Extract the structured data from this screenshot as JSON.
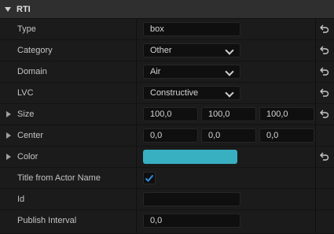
{
  "category": {
    "title": "RTI"
  },
  "rows": {
    "type": {
      "label": "Type",
      "value": "box"
    },
    "category": {
      "label": "Category",
      "value": "Other"
    },
    "domain": {
      "label": "Domain",
      "value": "Air"
    },
    "lvc": {
      "label": "LVC",
      "value": "Constructive"
    },
    "size": {
      "label": "Size",
      "x": "100,0",
      "y": "100,0",
      "z": "100,0"
    },
    "center": {
      "label": "Center",
      "x": "0,0",
      "y": "0,0",
      "z": "0,0"
    },
    "color": {
      "label": "Color",
      "swatch": "#38b0c2"
    },
    "title_from_actor": {
      "label": "Title from Actor Name",
      "checked": true
    },
    "id": {
      "label": "Id",
      "value": ""
    },
    "publish_interval": {
      "label": "Publish Interval",
      "value": "0,0"
    }
  },
  "icons": {
    "reset": "reset-arrow-icon",
    "expander": "expander-arrow-icon",
    "category_caret": "caret-down-icon",
    "dropdown": "chevron-down-icon",
    "checkmark": "checkmark-icon"
  },
  "colors": {
    "accent": "#38b0c2",
    "check": "#2f8fe0"
  }
}
